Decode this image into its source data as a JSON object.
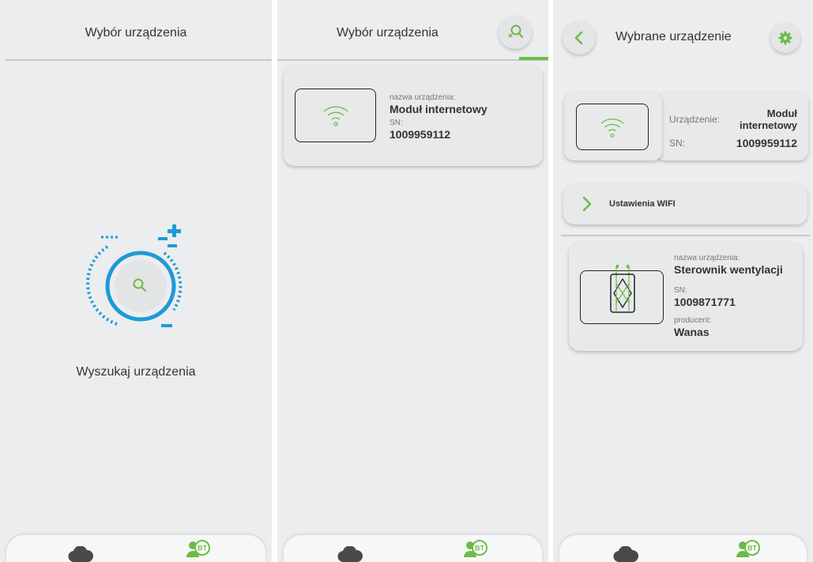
{
  "panel1": {
    "title": "Wybór urządzenia",
    "search_label": "Wyszukaj urządzenia"
  },
  "panel2": {
    "title": "Wybór urządzenia",
    "device": {
      "name_label": "nazwa urządzenia:",
      "name": "Moduł internetowy",
      "sn_label": "SN:",
      "sn": "1009959112"
    }
  },
  "panel3": {
    "title": "Wybrane urządzenie",
    "selected": {
      "device_label": "Urządzenie:",
      "device_name_line1": "Moduł",
      "device_name_line2": "internetowy",
      "sn_label": "SN:",
      "sn": "1009959112"
    },
    "wifi_settings": "Ustawienia WIFI",
    "controller": {
      "name_label": "nazwa urządzenia:",
      "name": "Sterownik wentylacji",
      "sn_label": "SN:",
      "sn": "1009871771",
      "producer_label": "producent:",
      "producer": "Wanas"
    }
  },
  "nav": {
    "cloud_icon": "cloud-icon",
    "bt_icon": "user-bluetooth-icon",
    "bt_text": "BT"
  },
  "colors": {
    "accent_green": "#6dbb45",
    "accent_blue": "#1e9ad6",
    "background": "#ebedef"
  }
}
